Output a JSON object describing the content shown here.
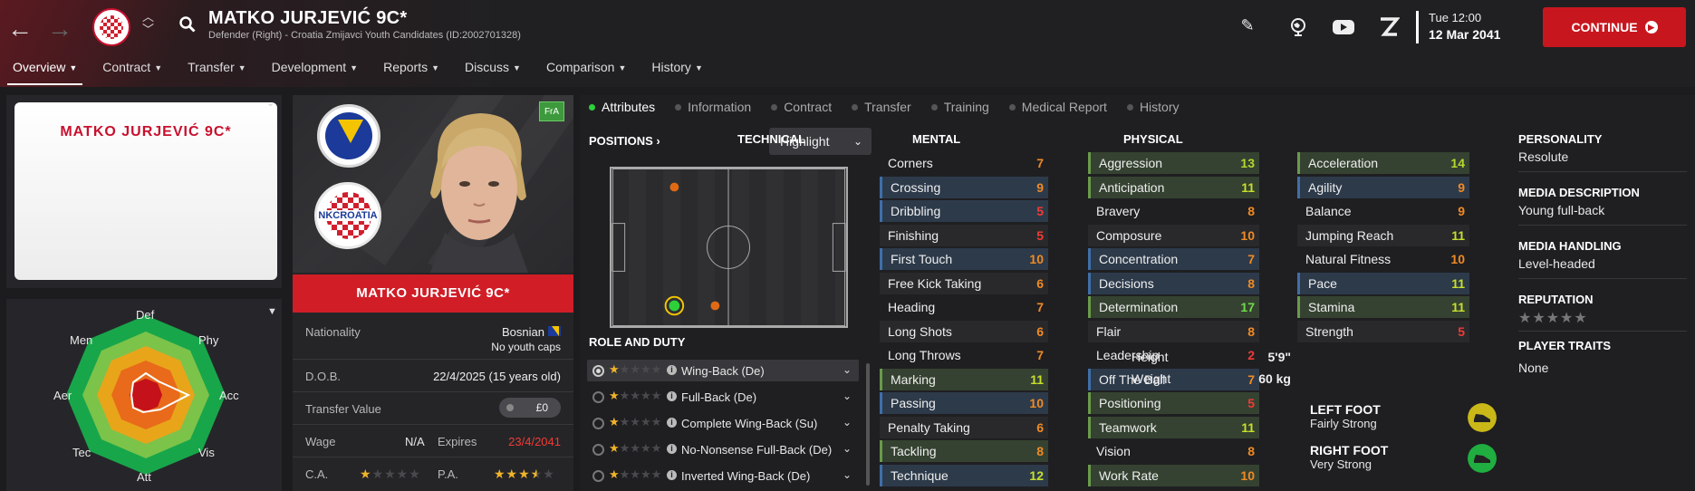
{
  "header": {
    "player_name": "MATKO JURJEVIĆ 9C*",
    "subtitle": "Defender (Right) - Croatia Zmijavci Youth Candidates (ID:2002701328)",
    "date_line1": "Tue 12:00",
    "date_line2": "12 Mar 2041",
    "continue_label": "CONTINUE"
  },
  "tabs": [
    "Overview",
    "Contract",
    "Transfer",
    "Development",
    "Reports",
    "Discuss",
    "Comparison",
    "History"
  ],
  "kit_name": "MATKO JURJEVIĆ 9C*",
  "radar": {
    "labels": [
      "Def",
      "Phy",
      "Acc",
      "Vis",
      "Att",
      "Tec",
      "Aer",
      "Men"
    ]
  },
  "profile": {
    "lang_badge": "FrA",
    "name_bar": "MATKO JURJEVIĆ 9C*",
    "club_text": "NKCROATIA",
    "nationality_label": "Nationality",
    "nationality_value": "Bosnian",
    "youth_caps": "No youth caps",
    "dob_label": "D.O.B.",
    "dob_value": "22/4/2025 (15 years old)",
    "transfer_label": "Transfer Value",
    "transfer_value": "£0",
    "wage_label": "Wage",
    "wage_value": "N/A",
    "expires_label": "Expires",
    "expires_value": "23/4/2041",
    "ca_label": "C.A.",
    "pa_label": "P.A.",
    "ca_stars": 1,
    "pa_stars": 3.5
  },
  "subtabs": [
    "Attributes",
    "Information",
    "Contract",
    "Transfer",
    "Training",
    "Medical Report",
    "History"
  ],
  "positions": {
    "heading": "POSITIONS",
    "highlight_label": "Highlight"
  },
  "roles": {
    "heading": "ROLE AND DUTY",
    "items": [
      {
        "name": "Wing-Back (De)",
        "stars": 1,
        "selected": true
      },
      {
        "name": "Full-Back (De)",
        "stars": 1,
        "selected": false
      },
      {
        "name": "Complete Wing-Back (Su)",
        "stars": 1,
        "selected": false
      },
      {
        "name": "No-Nonsense Full-Back (De)",
        "stars": 1,
        "selected": false
      },
      {
        "name": "Inverted Wing-Back (De)",
        "stars": 1,
        "selected": false
      }
    ]
  },
  "technical": {
    "heading": "TECHNICAL",
    "items": [
      {
        "name": "Corners",
        "value": "7"
      },
      {
        "name": "Crossing",
        "value": "9"
      },
      {
        "name": "Dribbling",
        "value": "5"
      },
      {
        "name": "Finishing",
        "value": "5"
      },
      {
        "name": "First Touch",
        "value": "10"
      },
      {
        "name": "Free Kick Taking",
        "value": "6"
      },
      {
        "name": "Heading",
        "value": "7"
      },
      {
        "name": "Long Shots",
        "value": "6"
      },
      {
        "name": "Long Throws",
        "value": "7"
      },
      {
        "name": "Marking",
        "value": "11"
      },
      {
        "name": "Passing",
        "value": "10"
      },
      {
        "name": "Penalty Taking",
        "value": "6"
      },
      {
        "name": "Tackling",
        "value": "8"
      },
      {
        "name": "Technique",
        "value": "12"
      }
    ]
  },
  "mental": {
    "heading": "MENTAL",
    "items": [
      {
        "name": "Aggression",
        "value": "13"
      },
      {
        "name": "Anticipation",
        "value": "11"
      },
      {
        "name": "Bravery",
        "value": "8"
      },
      {
        "name": "Composure",
        "value": "10"
      },
      {
        "name": "Concentration",
        "value": "7"
      },
      {
        "name": "Decisions",
        "value": "8"
      },
      {
        "name": "Determination",
        "value": "17"
      },
      {
        "name": "Flair",
        "value": "8"
      },
      {
        "name": "Leadership",
        "value": "2"
      },
      {
        "name": "Off The Ball",
        "value": "7"
      },
      {
        "name": "Positioning",
        "value": "5"
      },
      {
        "name": "Teamwork",
        "value": "11"
      },
      {
        "name": "Vision",
        "value": "8"
      },
      {
        "name": "Work Rate",
        "value": "10"
      }
    ]
  },
  "physical": {
    "heading": "PHYSICAL",
    "items": [
      {
        "name": "Acceleration",
        "value": "14"
      },
      {
        "name": "Agility",
        "value": "9"
      },
      {
        "name": "Balance",
        "value": "9"
      },
      {
        "name": "Jumping Reach",
        "value": "11"
      },
      {
        "name": "Natural Fitness",
        "value": "10"
      },
      {
        "name": "Pace",
        "value": "11"
      },
      {
        "name": "Stamina",
        "value": "11"
      },
      {
        "name": "Strength",
        "value": "5"
      }
    ],
    "height_label": "Height",
    "height_value": "5'9\"",
    "weight_label": "Weight",
    "weight_value": "60 kg",
    "left_foot_label": "LEFT FOOT",
    "left_foot_value": "Fairly Strong",
    "right_foot_label": "RIGHT FOOT",
    "right_foot_value": "Very Strong"
  },
  "personality": {
    "personality_label": "PERSONALITY",
    "personality_value": "Resolute",
    "media_desc_label": "MEDIA DESCRIPTION",
    "media_desc_value": "Young full-back",
    "media_handling_label": "MEDIA HANDLING",
    "media_handling_value": "Level-headed",
    "reputation_label": "REPUTATION",
    "reputation_stars": 0,
    "traits_label": "PLAYER TRAITS",
    "traits_value": "None"
  }
}
